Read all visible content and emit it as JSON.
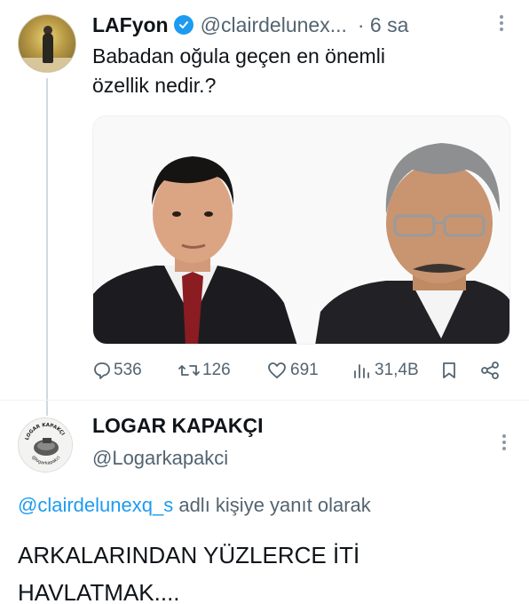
{
  "tweet": {
    "display_name": "LAFyon",
    "handle": "@clairdelunex...",
    "time": "· 6 sa",
    "text_line1": "Babadan oğula geçen en önemli",
    "text_line2": "özellik nedir.?",
    "stats": {
      "replies": "536",
      "retweets": "126",
      "likes": "691",
      "views": "31,4B"
    }
  },
  "reply": {
    "display_name": "LOGAR KAPAKÇI",
    "handle": "@Logarkapakci",
    "avatar_text_top": "LOGAR KAPAKÇI",
    "avatar_text_bottom": "@logarkapakci",
    "reply_to_mention": "@clairdelunexq_s",
    "reply_to_suffix": " adlı kişiye yanıt olarak",
    "text_line1": "ARKALARINDAN YÜZLERCE İTİ",
    "text_line2": "HAVLATMAK...."
  },
  "colors": {
    "accent": "#1d9bf0",
    "text": "#0f1419",
    "muted": "#536471"
  }
}
